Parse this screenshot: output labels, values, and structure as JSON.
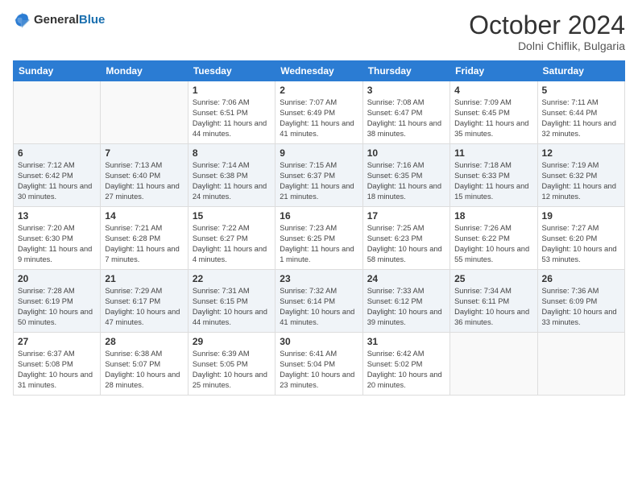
{
  "header": {
    "logo_general": "General",
    "logo_blue": "Blue",
    "month_title": "October 2024",
    "subtitle": "Dolni Chiflik, Bulgaria"
  },
  "days_of_week": [
    "Sunday",
    "Monday",
    "Tuesday",
    "Wednesday",
    "Thursday",
    "Friday",
    "Saturday"
  ],
  "weeks": [
    [
      {
        "day": "",
        "sunrise": "",
        "sunset": "",
        "daylight": ""
      },
      {
        "day": "",
        "sunrise": "",
        "sunset": "",
        "daylight": ""
      },
      {
        "day": "1",
        "sunrise": "Sunrise: 7:06 AM",
        "sunset": "Sunset: 6:51 PM",
        "daylight": "Daylight: 11 hours and 44 minutes."
      },
      {
        "day": "2",
        "sunrise": "Sunrise: 7:07 AM",
        "sunset": "Sunset: 6:49 PM",
        "daylight": "Daylight: 11 hours and 41 minutes."
      },
      {
        "day": "3",
        "sunrise": "Sunrise: 7:08 AM",
        "sunset": "Sunset: 6:47 PM",
        "daylight": "Daylight: 11 hours and 38 minutes."
      },
      {
        "day": "4",
        "sunrise": "Sunrise: 7:09 AM",
        "sunset": "Sunset: 6:45 PM",
        "daylight": "Daylight: 11 hours and 35 minutes."
      },
      {
        "day": "5",
        "sunrise": "Sunrise: 7:11 AM",
        "sunset": "Sunset: 6:44 PM",
        "daylight": "Daylight: 11 hours and 32 minutes."
      }
    ],
    [
      {
        "day": "6",
        "sunrise": "Sunrise: 7:12 AM",
        "sunset": "Sunset: 6:42 PM",
        "daylight": "Daylight: 11 hours and 30 minutes."
      },
      {
        "day": "7",
        "sunrise": "Sunrise: 7:13 AM",
        "sunset": "Sunset: 6:40 PM",
        "daylight": "Daylight: 11 hours and 27 minutes."
      },
      {
        "day": "8",
        "sunrise": "Sunrise: 7:14 AM",
        "sunset": "Sunset: 6:38 PM",
        "daylight": "Daylight: 11 hours and 24 minutes."
      },
      {
        "day": "9",
        "sunrise": "Sunrise: 7:15 AM",
        "sunset": "Sunset: 6:37 PM",
        "daylight": "Daylight: 11 hours and 21 minutes."
      },
      {
        "day": "10",
        "sunrise": "Sunrise: 7:16 AM",
        "sunset": "Sunset: 6:35 PM",
        "daylight": "Daylight: 11 hours and 18 minutes."
      },
      {
        "day": "11",
        "sunrise": "Sunrise: 7:18 AM",
        "sunset": "Sunset: 6:33 PM",
        "daylight": "Daylight: 11 hours and 15 minutes."
      },
      {
        "day": "12",
        "sunrise": "Sunrise: 7:19 AM",
        "sunset": "Sunset: 6:32 PM",
        "daylight": "Daylight: 11 hours and 12 minutes."
      }
    ],
    [
      {
        "day": "13",
        "sunrise": "Sunrise: 7:20 AM",
        "sunset": "Sunset: 6:30 PM",
        "daylight": "Daylight: 11 hours and 9 minutes."
      },
      {
        "day": "14",
        "sunrise": "Sunrise: 7:21 AM",
        "sunset": "Sunset: 6:28 PM",
        "daylight": "Daylight: 11 hours and 7 minutes."
      },
      {
        "day": "15",
        "sunrise": "Sunrise: 7:22 AM",
        "sunset": "Sunset: 6:27 PM",
        "daylight": "Daylight: 11 hours and 4 minutes."
      },
      {
        "day": "16",
        "sunrise": "Sunrise: 7:23 AM",
        "sunset": "Sunset: 6:25 PM",
        "daylight": "Daylight: 11 hours and 1 minute."
      },
      {
        "day": "17",
        "sunrise": "Sunrise: 7:25 AM",
        "sunset": "Sunset: 6:23 PM",
        "daylight": "Daylight: 10 hours and 58 minutes."
      },
      {
        "day": "18",
        "sunrise": "Sunrise: 7:26 AM",
        "sunset": "Sunset: 6:22 PM",
        "daylight": "Daylight: 10 hours and 55 minutes."
      },
      {
        "day": "19",
        "sunrise": "Sunrise: 7:27 AM",
        "sunset": "Sunset: 6:20 PM",
        "daylight": "Daylight: 10 hours and 53 minutes."
      }
    ],
    [
      {
        "day": "20",
        "sunrise": "Sunrise: 7:28 AM",
        "sunset": "Sunset: 6:19 PM",
        "daylight": "Daylight: 10 hours and 50 minutes."
      },
      {
        "day": "21",
        "sunrise": "Sunrise: 7:29 AM",
        "sunset": "Sunset: 6:17 PM",
        "daylight": "Daylight: 10 hours and 47 minutes."
      },
      {
        "day": "22",
        "sunrise": "Sunrise: 7:31 AM",
        "sunset": "Sunset: 6:15 PM",
        "daylight": "Daylight: 10 hours and 44 minutes."
      },
      {
        "day": "23",
        "sunrise": "Sunrise: 7:32 AM",
        "sunset": "Sunset: 6:14 PM",
        "daylight": "Daylight: 10 hours and 41 minutes."
      },
      {
        "day": "24",
        "sunrise": "Sunrise: 7:33 AM",
        "sunset": "Sunset: 6:12 PM",
        "daylight": "Daylight: 10 hours and 39 minutes."
      },
      {
        "day": "25",
        "sunrise": "Sunrise: 7:34 AM",
        "sunset": "Sunset: 6:11 PM",
        "daylight": "Daylight: 10 hours and 36 minutes."
      },
      {
        "day": "26",
        "sunrise": "Sunrise: 7:36 AM",
        "sunset": "Sunset: 6:09 PM",
        "daylight": "Daylight: 10 hours and 33 minutes."
      }
    ],
    [
      {
        "day": "27",
        "sunrise": "Sunrise: 6:37 AM",
        "sunset": "Sunset: 5:08 PM",
        "daylight": "Daylight: 10 hours and 31 minutes."
      },
      {
        "day": "28",
        "sunrise": "Sunrise: 6:38 AM",
        "sunset": "Sunset: 5:07 PM",
        "daylight": "Daylight: 10 hours and 28 minutes."
      },
      {
        "day": "29",
        "sunrise": "Sunrise: 6:39 AM",
        "sunset": "Sunset: 5:05 PM",
        "daylight": "Daylight: 10 hours and 25 minutes."
      },
      {
        "day": "30",
        "sunrise": "Sunrise: 6:41 AM",
        "sunset": "Sunset: 5:04 PM",
        "daylight": "Daylight: 10 hours and 23 minutes."
      },
      {
        "day": "31",
        "sunrise": "Sunrise: 6:42 AM",
        "sunset": "Sunset: 5:02 PM",
        "daylight": "Daylight: 10 hours and 20 minutes."
      },
      {
        "day": "",
        "sunrise": "",
        "sunset": "",
        "daylight": ""
      },
      {
        "day": "",
        "sunrise": "",
        "sunset": "",
        "daylight": ""
      }
    ]
  ]
}
